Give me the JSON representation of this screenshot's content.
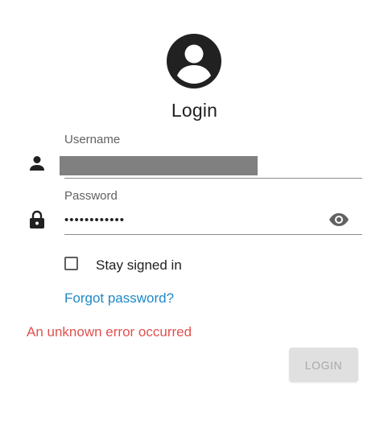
{
  "login": {
    "title": "Login",
    "username": {
      "label": "Username",
      "value": ""
    },
    "password": {
      "label": "Password",
      "value": "••••••••••••",
      "visibility_icon": "eye-icon"
    },
    "stay_signed_in": {
      "label": "Stay signed in",
      "checked": false
    },
    "forgot_password": "Forgot password?",
    "error": "An unknown error occurred",
    "submit_label": "LOGIN",
    "icons": {
      "avatar": "account-circle-icon",
      "user": "person-icon",
      "lock": "lock-icon"
    },
    "colors": {
      "link": "#1e88c7",
      "error": "#e0524f",
      "button_disabled_bg": "#e0e0e0",
      "button_disabled_text": "#a8a8a8"
    }
  }
}
